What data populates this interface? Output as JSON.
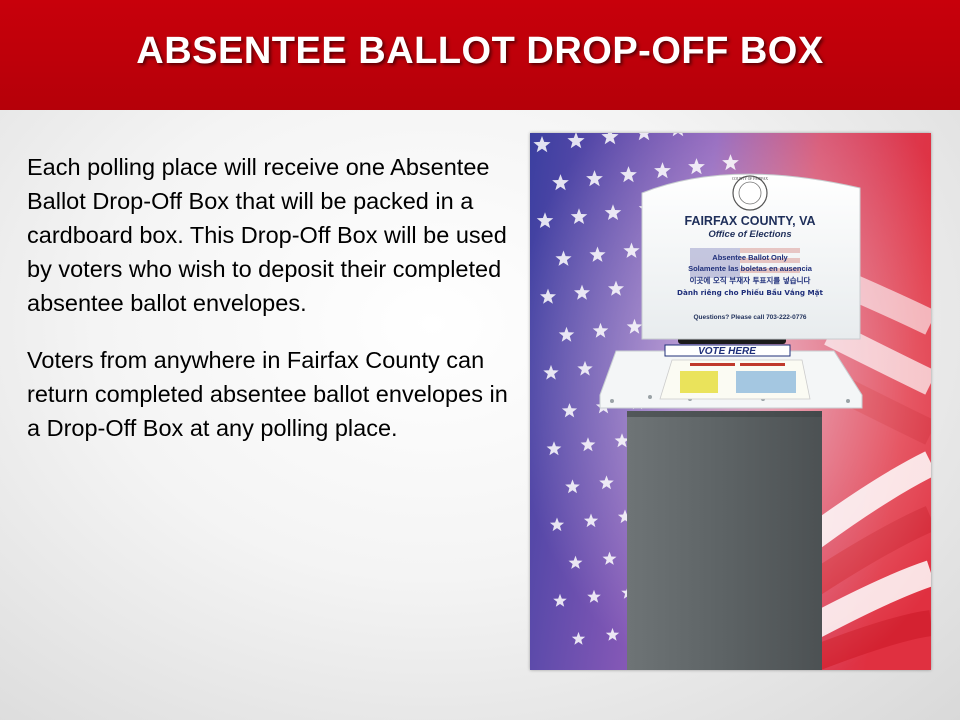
{
  "slide": {
    "title": "ABSENTEE BALLOT DROP-OFF BOX",
    "paragraphs": [
      "Each polling place will receive one Absentee Ballot Drop-Off Box that will be packed in a cardboard box. This Drop-Off Box will be used by voters who wish to deposit their completed absentee ballot envelopes.",
      "Voters from anywhere in Fairfax County can return completed absentee ballot envelopes in a Drop-Off Box at any polling place."
    ]
  },
  "photo": {
    "sign_county": "FAIRFAX COUNTY, VA",
    "sign_office": "Office of Elections",
    "sign_lines": [
      "Absentee Ballot Only",
      "Solamente las boletas en ausencia",
      "이곳에 오직 부재자 투표지를 넣습니다",
      "Dành riêng cho Phiếu Bầu Vắng Mặt"
    ],
    "sign_questions": "Questions? Please call 703-222-0776",
    "vote_here": "VOTE HERE",
    "seal_text": "COUNTY OF FAIRFAX",
    "colors": {
      "header": "#c00010",
      "flag_red": "#d01a2a",
      "flag_blue": "#3a3a9a",
      "box_gray": "#5e6466"
    }
  }
}
